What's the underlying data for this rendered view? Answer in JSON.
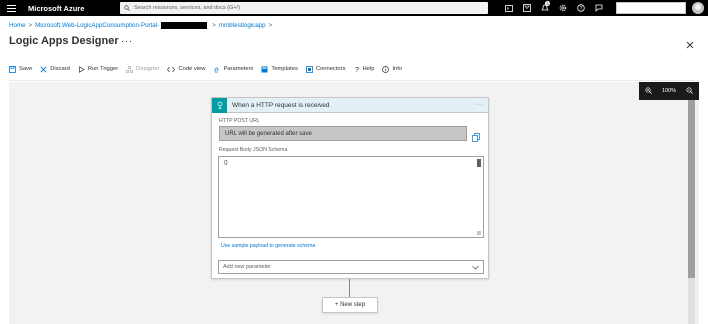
{
  "topbar": {
    "brand": "Microsoft Azure",
    "search_placeholder": "Search resources, services, and docs (G+/)",
    "notification_count": "3"
  },
  "breadcrumb": {
    "home": "Home",
    "resource_group": "Microsoft.Web-LogicAppConsumption-Portal-",
    "app": "mmbtestlogicapp"
  },
  "page": {
    "title": "Logic Apps Designer",
    "more": "···"
  },
  "toolbar": {
    "save": "Save",
    "discard": "Discard",
    "run_trigger": "Run Trigger",
    "designer": "Designer",
    "code_view": "Code view",
    "parameters": "Parameters",
    "templates": "Templates",
    "connectors": "Connectors",
    "help": "Help",
    "info": "Info"
  },
  "zoom": {
    "level": "100%"
  },
  "trigger_card": {
    "title": "When a HTTP request is received",
    "more": "···",
    "url_label": "HTTP POST URL",
    "url_value": "URL will be generated after save",
    "schema_label": "Request Body JSON Schema",
    "schema_value": "{}",
    "sample_link": "Use sample payload to generate schema",
    "add_param_placeholder": "Add new parameter"
  },
  "new_step": {
    "label": "+ New step"
  },
  "colors": {
    "topbar": "#000000",
    "link": "#0078d4",
    "trigger_icon": "#009da5",
    "card_header": "#e3f0f6",
    "canvas": "#f2f2f2"
  }
}
